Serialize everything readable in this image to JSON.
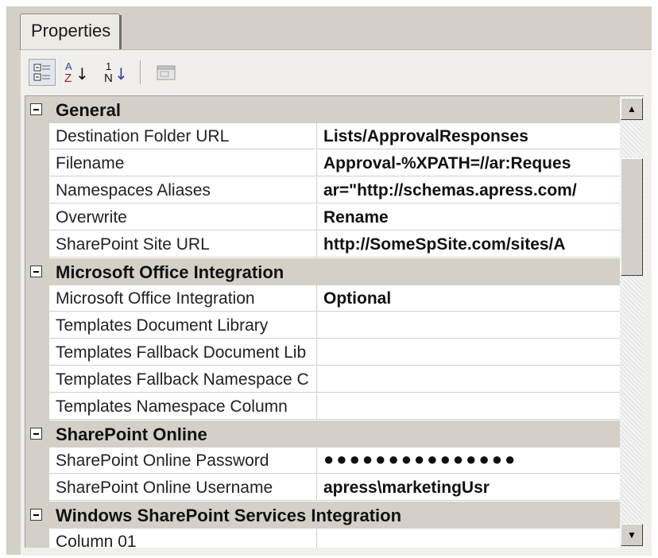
{
  "tab": {
    "label": "Properties"
  },
  "toolbar": {
    "categorized": {
      "icon": "categorized-icon"
    },
    "alphabetical": {
      "glyph_a": "A",
      "glyph_z": "Z",
      "arrow": "↓"
    },
    "order": {
      "glyph_1": "1",
      "glyph_n": "N",
      "arrow": "↓"
    },
    "pages": {
      "icon": "property-pages-icon"
    }
  },
  "grid": {
    "categories": [
      {
        "label": "General",
        "properties": [
          {
            "name": "Destination Folder URL",
            "value": "Lists/ApprovalResponses"
          },
          {
            "name": "Filename",
            "value": "Approval-%XPATH=//ar:Reques"
          },
          {
            "name": "Namespaces Aliases",
            "value": "ar=\"http://schemas.apress.com/"
          },
          {
            "name": "Overwrite",
            "value": "Rename"
          },
          {
            "name": "SharePoint Site URL",
            "value": "http://SomeSpSite.com/sites/A"
          }
        ]
      },
      {
        "label": "Microsoft Office Integration",
        "properties": [
          {
            "name": "Microsoft Office Integration",
            "value": "Optional"
          },
          {
            "name": "Templates Document Library",
            "value": ""
          },
          {
            "name": "Templates Fallback Document Lib",
            "value": ""
          },
          {
            "name": "Templates Fallback Namespace C",
            "value": ""
          },
          {
            "name": "Templates Namespace Column",
            "value": ""
          }
        ]
      },
      {
        "label": "SharePoint Online",
        "properties": [
          {
            "name": "SharePoint Online Password",
            "value": "●●●●●●●●●●●●●●●"
          },
          {
            "name": "SharePoint Online Username",
            "value": "apress\\marketingUsr"
          }
        ]
      },
      {
        "label": "Windows SharePoint Services Integration",
        "properties": [
          {
            "name": "Column 01",
            "value": ""
          }
        ]
      }
    ]
  },
  "scrollbar": {
    "up": "▲",
    "down": "▼"
  }
}
